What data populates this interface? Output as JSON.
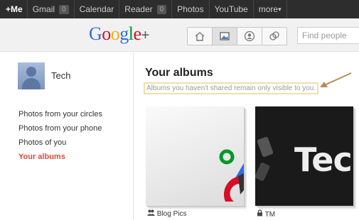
{
  "topbar": {
    "me": "+Me",
    "items": [
      {
        "label": "Gmail",
        "count": "0"
      },
      {
        "label": "Calendar"
      },
      {
        "label": "Reader",
        "count": "0"
      },
      {
        "label": "Photos"
      },
      {
        "label": "YouTube"
      },
      {
        "label": "more"
      }
    ]
  },
  "header": {
    "logo_text": "Google",
    "logo_plus": "+",
    "logo_colors": [
      "#3369e8",
      "#d50f25",
      "#eeb211",
      "#3369e8",
      "#009925",
      "#d50f25"
    ],
    "search_placeholder": "Find people",
    "nav_icons": [
      "home-icon",
      "photos-icon",
      "profile-icon",
      "circles-icon"
    ],
    "active_nav": "photos-icon"
  },
  "sidebar": {
    "username": "Tech",
    "items": [
      {
        "label": "Photos from your circles"
      },
      {
        "label": "Photos from your phone"
      },
      {
        "label": "Photos of you"
      },
      {
        "label": "Your albums",
        "active": true
      }
    ]
  },
  "main": {
    "title": "Your albums",
    "notice": "Albums you haven't shared remain only visible to you.",
    "albums": [
      {
        "name": "Blog Pics",
        "icon": "people-icon"
      },
      {
        "name": "TM",
        "icon": "lock-icon",
        "cover_text": "Tec"
      }
    ]
  },
  "colors": {
    "accent": "#dd4b39",
    "topbar": "#2d2d2d",
    "annotation": "#b98a5a"
  }
}
